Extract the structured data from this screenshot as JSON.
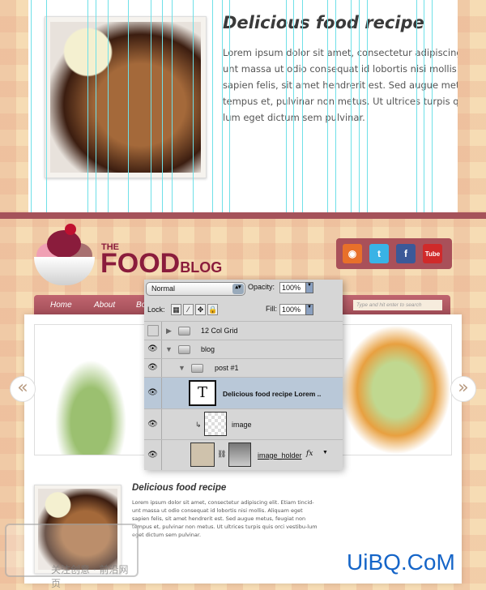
{
  "top_preview": {
    "title": "Delicious food recipe",
    "body": [
      "Lorem ipsum dolor sit amet, consectetur adipiscing elit. Etiam tincid-",
      "unt massa ut odio consequat id lobortis nisi mollis. Aliquam eget",
      "sapien felis, sit amet hendrerit est. Sed augue metus, feugiat non",
      "tempus et, pulvinar non metus. Ut ultrices turpis quis orci vestibu-",
      "lum eget dictum sem pulvinar."
    ]
  },
  "logo": {
    "the": "THE",
    "food": "FOOD",
    "blog": "BLOG"
  },
  "social": [
    {
      "icon": "rss-icon",
      "glyph": "◉",
      "color": "#e8702a"
    },
    {
      "icon": "twitter-icon",
      "glyph": "t",
      "color": "#39b3e6"
    },
    {
      "icon": "facebook-icon",
      "glyph": "f",
      "color": "#3b5998"
    },
    {
      "icon": "youtube-icon",
      "glyph": "Tube",
      "color": "#d02a2a"
    }
  ],
  "nav": {
    "items": [
      "Home",
      "About",
      "Bo"
    ],
    "search_placeholder": "Type and hit enter to search"
  },
  "slider": {
    "prev": "«",
    "next": "»"
  },
  "post": {
    "title": "Delicious food recipe",
    "body": "Lorem ipsum dolor sit amet, consectetur adipiscing elit. Etiam tincid-unt massa ut odio consequat id lobortis nisi mollis. Aliquam eget sapien felis, sit amet hendrerit est. Sed augue metus, feugiat non tempus et, pulvinar non metus. Ut ultrices turpis quis orci vestibu-lum eget dictum sem pulvinar."
  },
  "layers_panel": {
    "blend_mode": "Normal",
    "opacity_label": "Opacity:",
    "opacity": "100%",
    "lock_label": "Lock:",
    "fill_label": "Fill:",
    "fill": "100%",
    "layers": [
      {
        "name": "12 Col Grid",
        "visible": false
      },
      {
        "name": "blog",
        "visible": true
      },
      {
        "name": "post #1",
        "visible": true
      },
      {
        "name": "Delicious food recipe Lorem ..",
        "visible": true,
        "selected": true
      },
      {
        "name": "image",
        "visible": true
      },
      {
        "name": "image_holder",
        "visible": true,
        "fx": "fx"
      }
    ]
  },
  "watermarks": {
    "left": "关注创意 · 前沿网页",
    "right": "UiBQ.CoM"
  }
}
